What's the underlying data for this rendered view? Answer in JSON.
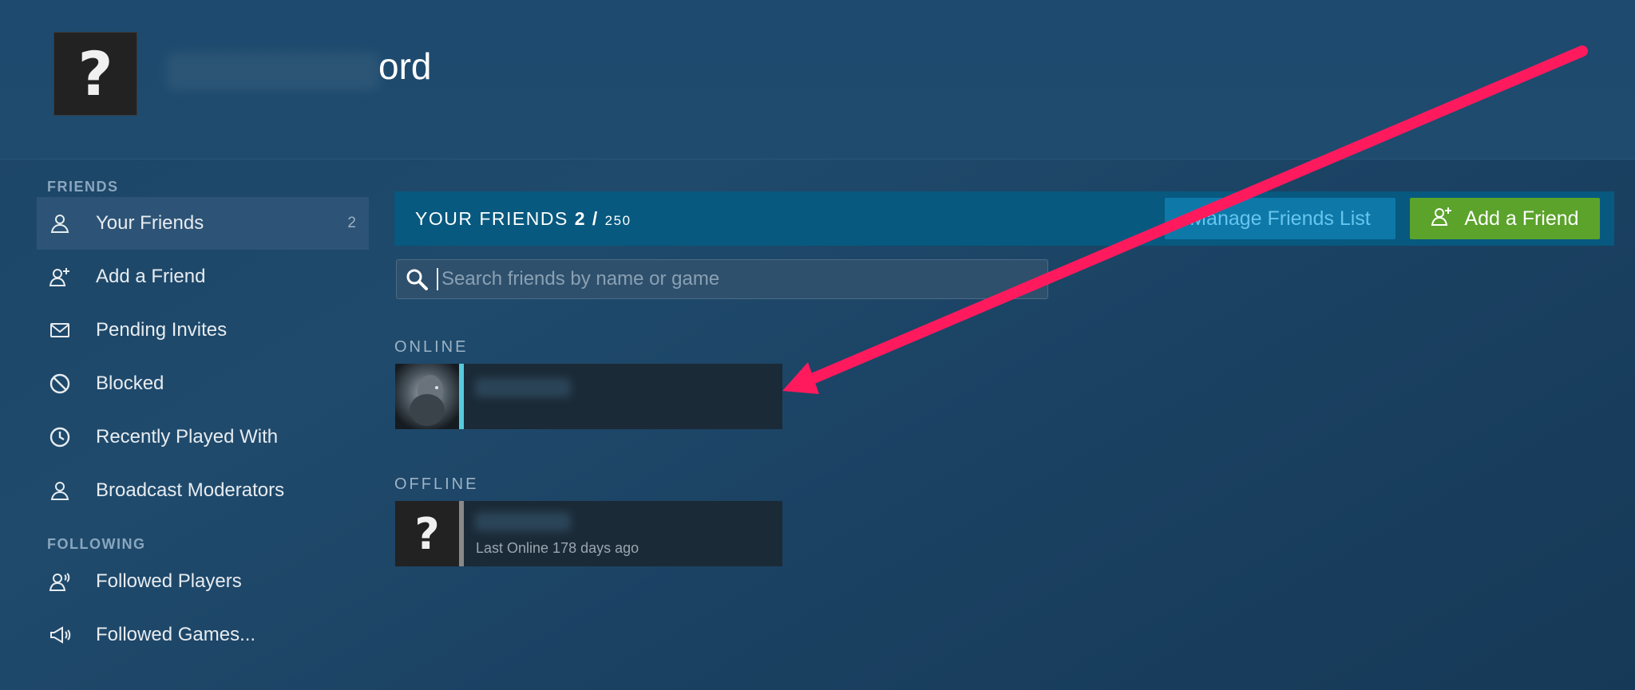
{
  "profile": {
    "name_visible_suffix": "ord"
  },
  "sidebar": {
    "friends_section": "FRIENDS",
    "following_section": "FOLLOWING",
    "items": [
      {
        "label": "Your Friends",
        "count": "2",
        "icon": "person-icon"
      },
      {
        "label": "Add a Friend",
        "icon": "add-person-icon"
      },
      {
        "label": "Pending Invites",
        "icon": "envelope-icon"
      },
      {
        "label": "Blocked",
        "icon": "blocked-icon"
      },
      {
        "label": "Recently Played With",
        "icon": "clock-icon"
      },
      {
        "label": "Broadcast Moderators",
        "icon": "person-icon"
      }
    ],
    "following_items": [
      {
        "label": "Followed Players",
        "icon": "followed-person-icon"
      },
      {
        "label": "Followed Games...",
        "icon": "megaphone-icon"
      }
    ]
  },
  "friends_header": {
    "title": "YOUR FRIENDS",
    "count": "2",
    "separator": "/",
    "limit": "250",
    "manage_button": "Manage Friends List",
    "add_button": "Add a Friend"
  },
  "search": {
    "placeholder": "Search friends by name or game"
  },
  "groups": {
    "online_label": "ONLINE",
    "offline_label": "OFFLINE",
    "offline_status": "Last Online 178 days ago"
  },
  "colors": {
    "online_stripe": "#57cbde",
    "offline_stripe": "#898989",
    "add_button": "#5ba32b",
    "annotation_arrow": "#ff1a5e"
  }
}
